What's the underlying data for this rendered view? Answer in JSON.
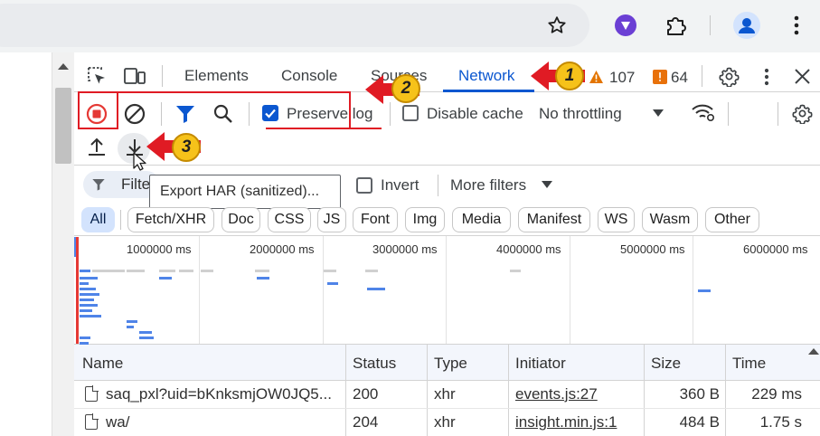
{
  "colors": {
    "accent": "#0b57d0",
    "record": "#e53935",
    "annotation_red": "#e01b24",
    "badge_yellow": "#f6c21a",
    "warning": "#e37400",
    "error": "#e8710a"
  },
  "browser": {
    "icons": [
      "star-icon",
      "vpn-extension-icon",
      "extensions-puzzle-icon",
      "profile-avatar-icon",
      "kebab-menu-icon"
    ]
  },
  "devtools": {
    "tabs": [
      {
        "label": "Elements"
      },
      {
        "label": "Console"
      },
      {
        "label": "Sources"
      },
      {
        "label": "Network",
        "active": true
      }
    ],
    "warnings_count": "107",
    "errors_count": "64",
    "toolbar": {
      "preserve_log_label": "Preserve log",
      "preserve_log_checked": true,
      "disable_cache_label": "Disable cache",
      "disable_cache_checked": false,
      "throttling": "No throttling"
    },
    "tooltip": "Export HAR (sanitized)...",
    "filter": {
      "placeholder": "Filter",
      "invert_label": "Invert",
      "more_filters_label": "More filters"
    },
    "type_filters": [
      "All",
      "Fetch/XHR",
      "Doc",
      "CSS",
      "JS",
      "Font",
      "Img",
      "Media",
      "Manifest",
      "WS",
      "Wasm",
      "Other"
    ],
    "timeline_ticks": [
      "1000000 ms",
      "2000000 ms",
      "3000000 ms",
      "4000000 ms",
      "5000000 ms",
      "6000000 ms"
    ],
    "table": {
      "columns": [
        "Name",
        "Status",
        "Type",
        "Initiator",
        "Size",
        "Time"
      ],
      "rows": [
        {
          "name": "saq_pxl?uid=bKnksmjOW0JQ5...",
          "status": "200",
          "type": "xhr",
          "initiator": "events.js:27",
          "size": "360 B",
          "time": "229 ms"
        },
        {
          "name": "wa/",
          "status": "204",
          "type": "xhr",
          "initiator": "insight.min.js:1",
          "size": "484 B",
          "time": "1.75 s"
        }
      ]
    }
  },
  "annotations": [
    "1",
    "2",
    "3"
  ]
}
